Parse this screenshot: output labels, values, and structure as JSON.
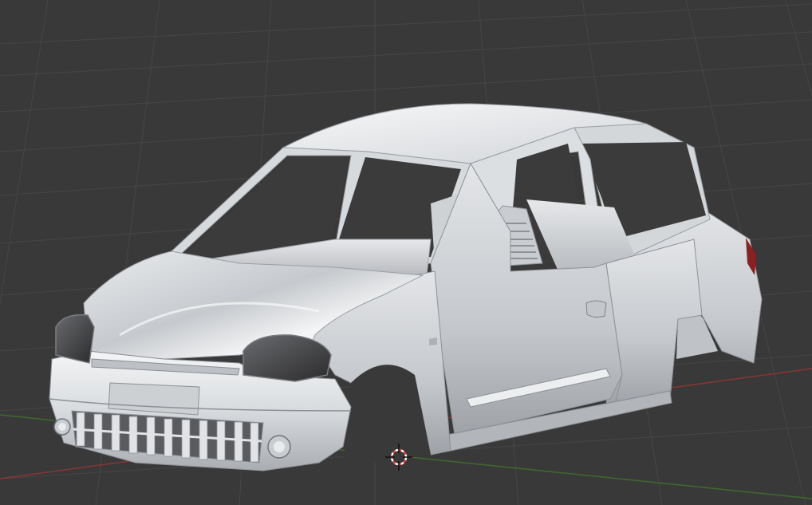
{
  "viewport": {
    "background": "#393939",
    "grid_color": "#454545",
    "axis_x_color": "#8a3535",
    "axis_y_color": "#3f6a2c"
  },
  "scene": {
    "object": "car-body-shell",
    "material_color": "#d9dcdf",
    "glass_color": "#4a4a4c",
    "taillight_color": "#8c1f1f"
  },
  "cursor_3d": {
    "ring_color_a": "#e04040",
    "ring_color_b": "#ffffff",
    "crosshair_color": "#111111"
  }
}
